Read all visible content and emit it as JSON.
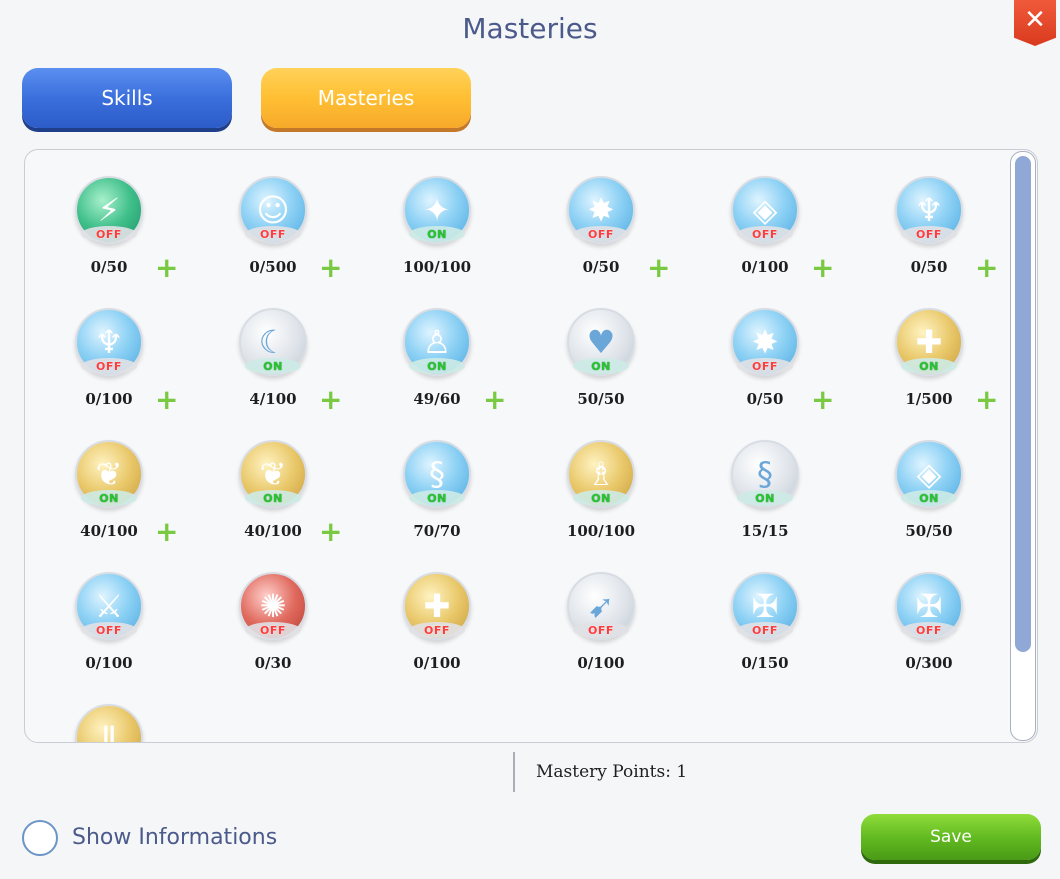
{
  "window": {
    "title": "Masteries",
    "close_label": "✕"
  },
  "tabs": {
    "skills": "Skills",
    "masteries": "Masteries"
  },
  "masteries": [
    {
      "icon": "lightning-rune-icon",
      "color": "green",
      "status": "OFF",
      "level": "0/50",
      "upgradable": true
    },
    {
      "icon": "halo-figure-icon",
      "color": "blue",
      "status": "OFF",
      "level": "0/500",
      "upgradable": true
    },
    {
      "icon": "feather-wing-icon",
      "color": "blue",
      "status": "ON",
      "level": "100/100",
      "upgradable": false
    },
    {
      "icon": "burst-figure-icon",
      "color": "blue",
      "status": "OFF",
      "level": "0/50",
      "upgradable": true
    },
    {
      "icon": "crystal-ring-icon",
      "color": "blue",
      "status": "OFF",
      "level": "0/100",
      "upgradable": true
    },
    {
      "icon": "arms-up-figure-icon",
      "color": "blue",
      "status": "OFF",
      "level": "0/50",
      "upgradable": true
    },
    {
      "icon": "arms-up-figure-icon",
      "color": "blue",
      "status": "OFF",
      "level": "0/100",
      "upgradable": true
    },
    {
      "icon": "crescent-blade-icon",
      "color": "gray",
      "status": "ON",
      "level": "4/100",
      "upgradable": true
    },
    {
      "icon": "standing-figure-icon",
      "color": "blue",
      "status": "ON",
      "level": "49/60",
      "upgradable": true
    },
    {
      "icon": "heart-ribbon-icon",
      "color": "gray",
      "status": "ON",
      "level": "50/50",
      "upgradable": false
    },
    {
      "icon": "burst-figure-icon",
      "color": "blue",
      "status": "OFF",
      "level": "0/50",
      "upgradable": true
    },
    {
      "icon": "holy-shield-icon",
      "color": "gold",
      "status": "ON",
      "level": "1/500",
      "upgradable": true
    },
    {
      "icon": "swirl-spirit-icon",
      "color": "gold",
      "status": "ON",
      "level": "40/100",
      "upgradable": true
    },
    {
      "icon": "swirl-spirit-icon",
      "color": "gold",
      "status": "ON",
      "level": "40/100",
      "upgradable": true
    },
    {
      "icon": "serpent-icon",
      "color": "blue",
      "status": "ON",
      "level": "70/70",
      "upgradable": false
    },
    {
      "icon": "healer-figure-icon",
      "color": "gold",
      "status": "ON",
      "level": "100/100",
      "upgradable": false
    },
    {
      "icon": "serpent-icon",
      "color": "gray",
      "status": "ON",
      "level": "15/15",
      "upgradable": false
    },
    {
      "icon": "crystal-ring-icon",
      "color": "blue",
      "status": "ON",
      "level": "50/50",
      "upgradable": false
    },
    {
      "icon": "sword-icon",
      "color": "blue",
      "status": "OFF",
      "level": "0/100",
      "upgradable": false
    },
    {
      "icon": "blood-figure-icon",
      "color": "red",
      "status": "OFF",
      "level": "0/30",
      "upgradable": false
    },
    {
      "icon": "heart-cross-icon",
      "color": "gold",
      "status": "OFF",
      "level": "0/100",
      "upgradable": false
    },
    {
      "icon": "spear-icon",
      "color": "gray",
      "status": "OFF",
      "level": "0/100",
      "upgradable": false
    },
    {
      "icon": "cross-shield-icon",
      "color": "blue",
      "status": "OFF",
      "level": "0/150",
      "upgradable": false
    },
    {
      "icon": "cross-shield-icon",
      "color": "blue",
      "status": "OFF",
      "level": "0/300",
      "upgradable": false
    },
    {
      "icon": "gold-tome-icon",
      "color": "gold",
      "status": "",
      "level": "",
      "upgradable": false
    }
  ],
  "footer": {
    "mastery_points": "Mastery Points: 1",
    "show_info_label": "Show Informations",
    "save_label": "Save"
  }
}
